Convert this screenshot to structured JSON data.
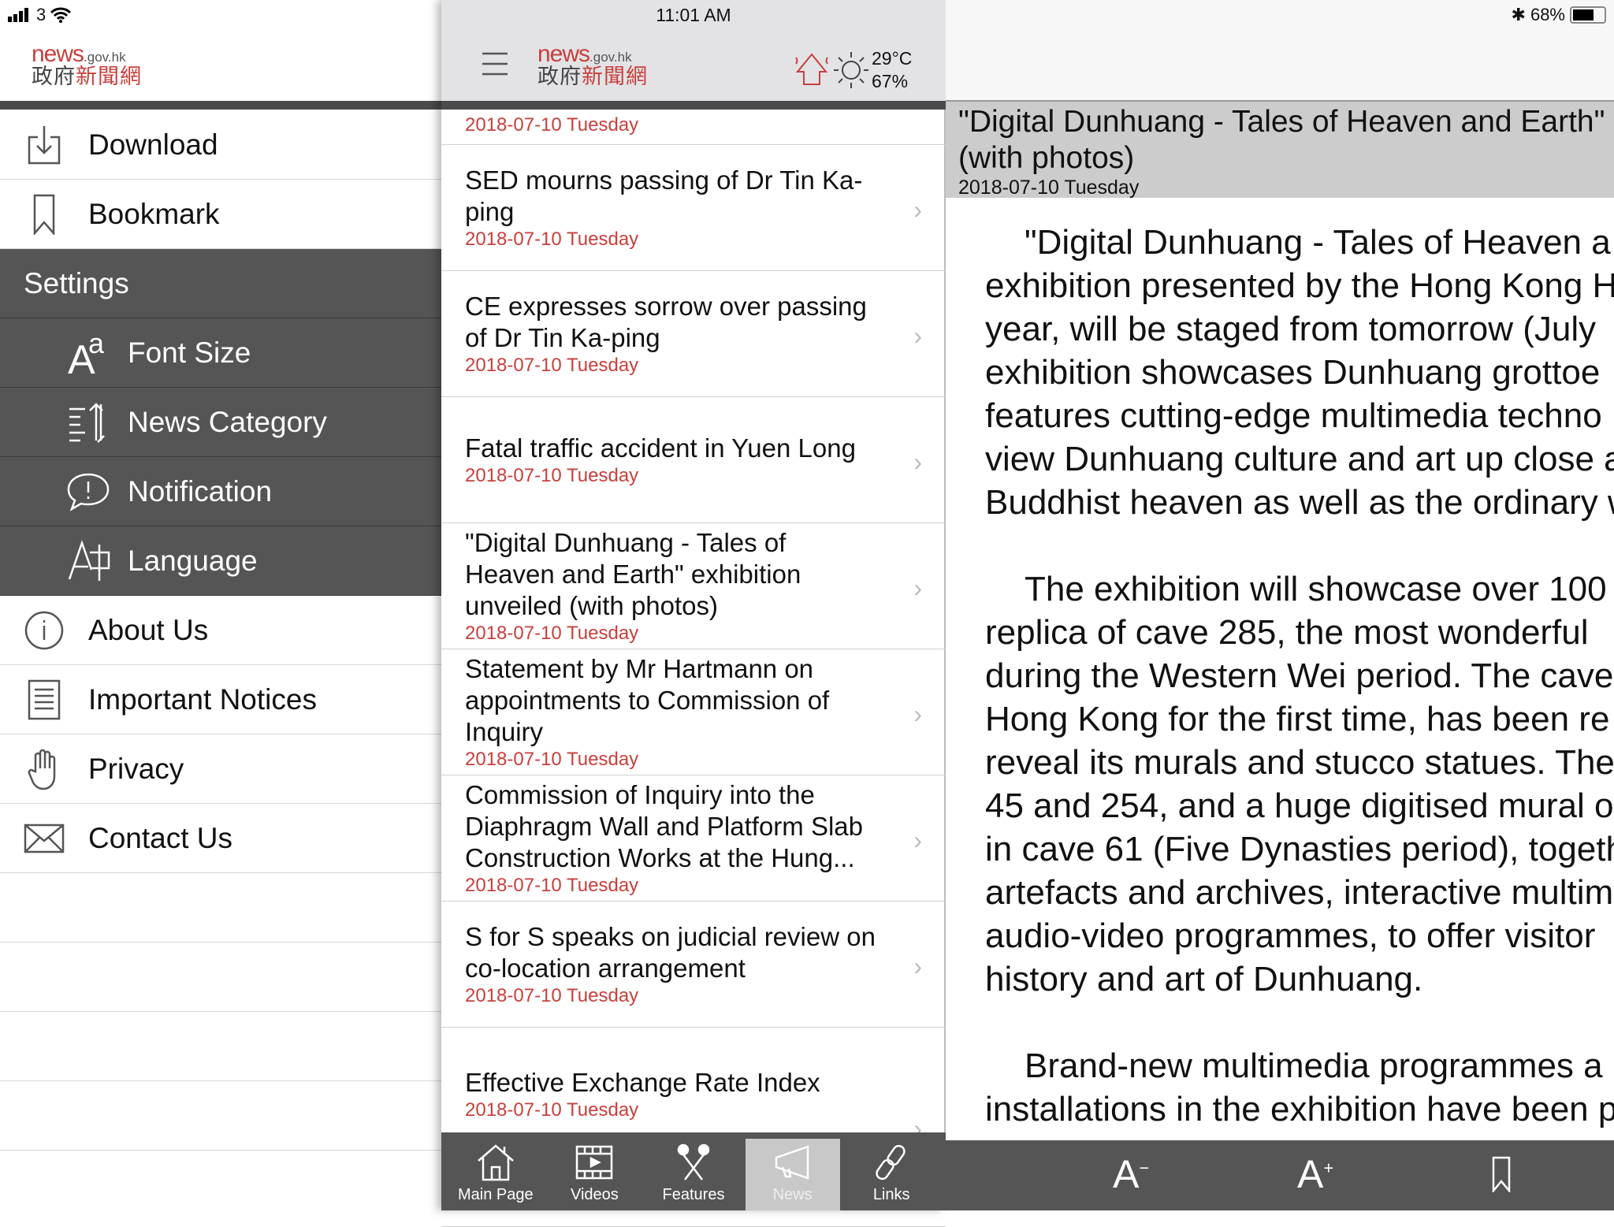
{
  "status_bar": {
    "carrier": "3",
    "time": "11:01 AM",
    "battery": "68%",
    "battery_level": 0.68
  },
  "logo": {
    "en": "news",
    "domain": ".gov.hk",
    "zh_grey": "政府",
    "zh_red": "新聞網"
  },
  "weather": {
    "temperature": "29°C",
    "humidity": "67%",
    "warning_icon": "very-hot-warning-icon",
    "condition_icon": "sunny-icon"
  },
  "sidebar": {
    "items": [
      {
        "label": "Download",
        "icon": "download-icon"
      },
      {
        "label": "Bookmark",
        "icon": "bookmark-icon"
      }
    ],
    "settings_header": "Settings",
    "settings_items": [
      {
        "label": "Font Size",
        "icon": "font-size-icon"
      },
      {
        "label": "News Category",
        "icon": "sort-icon"
      },
      {
        "label": "Notification",
        "icon": "notification-icon"
      },
      {
        "label": "Language",
        "icon": "language-icon"
      }
    ],
    "info_items": [
      {
        "label": "About Us",
        "icon": "info-icon"
      },
      {
        "label": "Important Notices",
        "icon": "document-icon"
      },
      {
        "label": "Privacy",
        "icon": "hand-icon"
      },
      {
        "label": "Contact Us",
        "icon": "mail-icon"
      }
    ]
  },
  "news_list": {
    "partial_item_date": "2018-07-10 Tuesday",
    "items": [
      {
        "title": "SED mourns passing of Dr Tin Ka-ping",
        "date": "2018-07-10 Tuesday"
      },
      {
        "title": "CE expresses sorrow over passing of Dr Tin Ka-ping",
        "date": "2018-07-10 Tuesday"
      },
      {
        "title": "Fatal traffic accident in Yuen Long",
        "date": "2018-07-10 Tuesday"
      },
      {
        "title": "\"Digital Dunhuang - Tales of Heaven and Earth\" exhibition unveiled (with photos)",
        "date": "2018-07-10 Tuesday"
      },
      {
        "title": "Statement by Mr Hartmann on appointments to Commission of Inquiry",
        "date": "2018-07-10 Tuesday"
      },
      {
        "title": "Commission of Inquiry into the Diaphragm Wall and Platform Slab Construction Works at the Hung...",
        "date": "2018-07-10 Tuesday"
      },
      {
        "title": "S for S speaks on judicial review on co-location arrangement",
        "date": "2018-07-10 Tuesday"
      },
      {
        "title": "Effective Exchange Rate Index",
        "date": "2018-07-10 Tuesday"
      }
    ]
  },
  "tabs": [
    {
      "label": "Main Page",
      "icon": "home-icon"
    },
    {
      "label": "Videos",
      "icon": "video-icon"
    },
    {
      "label": "Features",
      "icon": "features-icon"
    },
    {
      "label": "News",
      "icon": "megaphone-icon",
      "active": true
    },
    {
      "label": "Links",
      "icon": "link-icon"
    }
  ],
  "article": {
    "title": "\"Digital Dunhuang - Tales of Heaven and Earth\" (with photos)",
    "date": "2018-07-10 Tuesday",
    "paragraphs": [
      [
        "\"Digital Dunhuang - Tales of Heaven a",
        "exhibition presented by the Hong Kong H",
        "year, will be staged from tomorrow (July",
        "exhibition showcases Dunhuang grottoe",
        "features cutting-edge multimedia techno",
        "view Dunhuang culture and art up close a",
        "Buddhist heaven as well as the ordinary w"
      ],
      [
        "The exhibition will showcase over 100",
        "replica of cave 285, the most wonderful",
        "during the Western Wei period. The cave",
        "Hong Kong for the first time, has been re",
        "reveal its murals and stucco statues. The",
        "45 and 254, and a huge digitised mural o",
        "in cave 61 (Five Dynasties period), togeth",
        "artefacts and archives, interactive multim",
        "audio-video programmes, to offer visitor",
        "history and art of Dunhuang."
      ],
      [
        "Brand-new multimedia programmes a",
        "installations in the exhibition have been p"
      ]
    ]
  },
  "article_toolbar": {
    "decrease_font": "A",
    "decrease_sup": "−",
    "increase_font": "A",
    "increase_sup": "+"
  },
  "colors": {
    "brand_red": "#c8403c",
    "dark_panel": "#555555",
    "header_grey": "#cccccc"
  }
}
